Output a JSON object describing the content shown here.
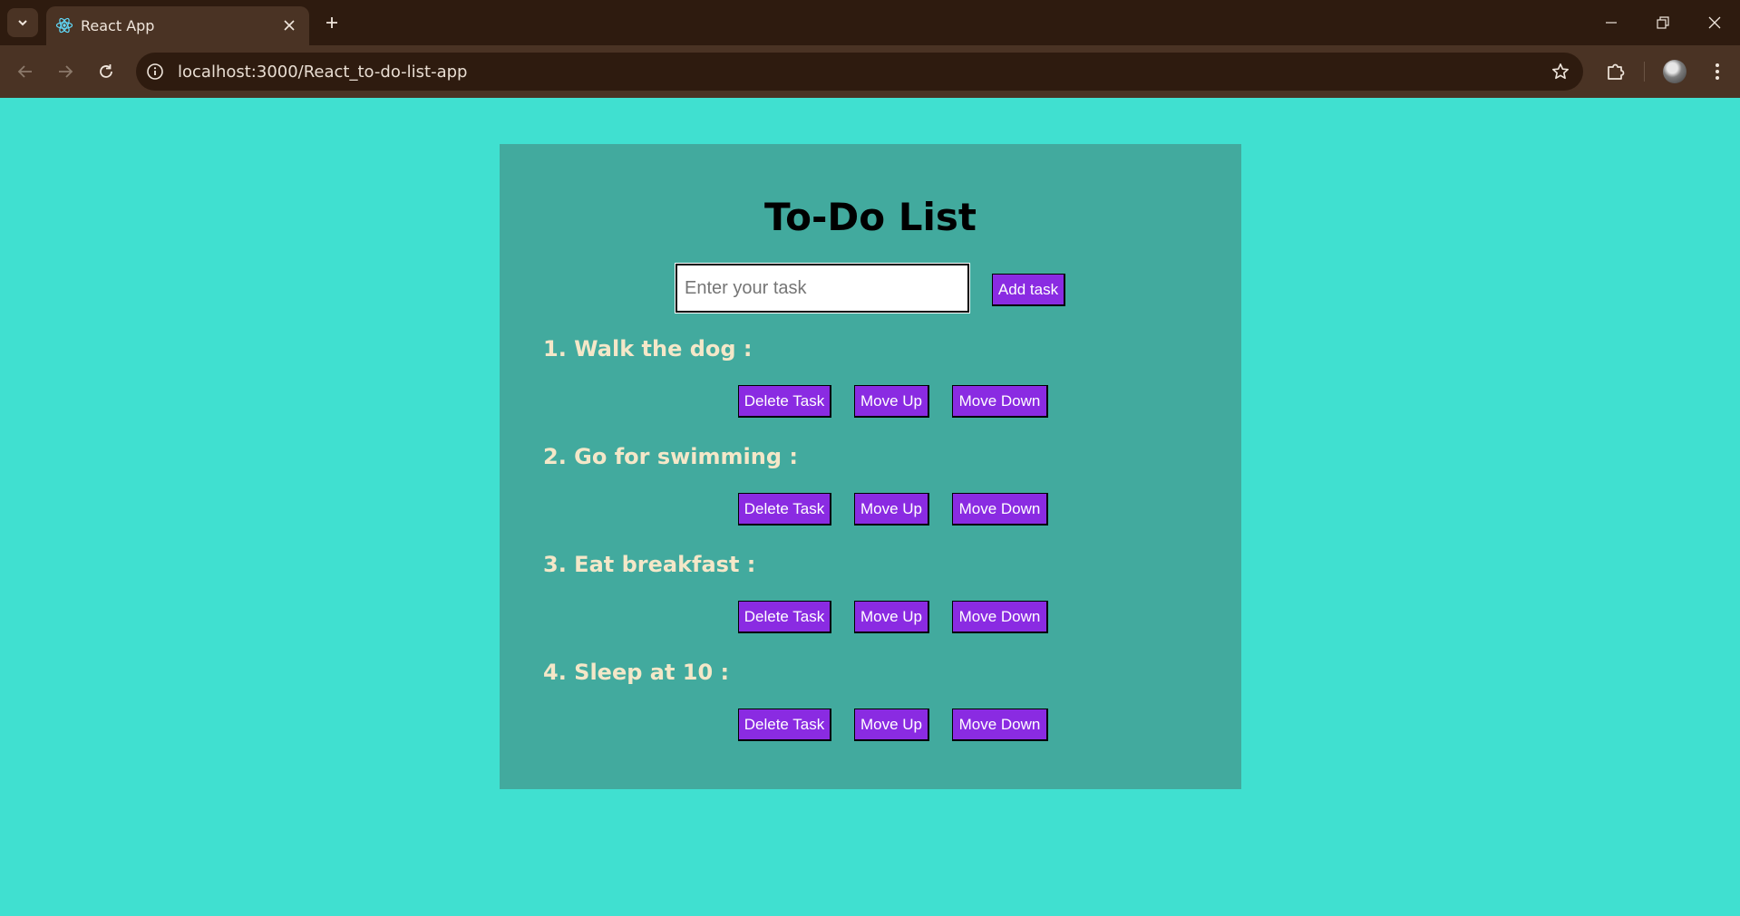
{
  "browser": {
    "tab_title": "React App",
    "url": "localhost:3000/React_to-do-list-app",
    "icons": {
      "tab_search": "chevron-down-icon",
      "favicon": "react-icon",
      "tab_close": "close-icon",
      "new_tab": "plus-icon",
      "minimize": "minimize-icon",
      "restore": "restore-icon",
      "close": "close-icon",
      "back": "back-arrow-icon",
      "forward": "forward-arrow-icon",
      "reload": "reload-icon",
      "site_info": "info-icon",
      "bookmark": "star-icon",
      "extensions": "puzzle-icon",
      "profile": "avatar",
      "menu": "kebab-menu-icon"
    }
  },
  "app": {
    "title": "To-Do List",
    "input_placeholder": "Enter your task",
    "input_value": "",
    "add_button": "Add task",
    "tasks": [
      {
        "label": "1. Walk the dog :"
      },
      {
        "label": "2. Go for swimming :"
      },
      {
        "label": "3. Eat breakfast :"
      },
      {
        "label": "4. Sleep at 10 :"
      }
    ],
    "task_buttons": {
      "delete": "Delete Task",
      "move_up": "Move Up",
      "move_down": "Move Down"
    }
  },
  "colors": {
    "page_background": "#40e0d0",
    "container_background": "#42aa9e",
    "button_background": "#8a2be2",
    "task_text": "#f4e7c8",
    "browser_frame": "#2e1b0f",
    "browser_toolbar": "#4a3324"
  }
}
